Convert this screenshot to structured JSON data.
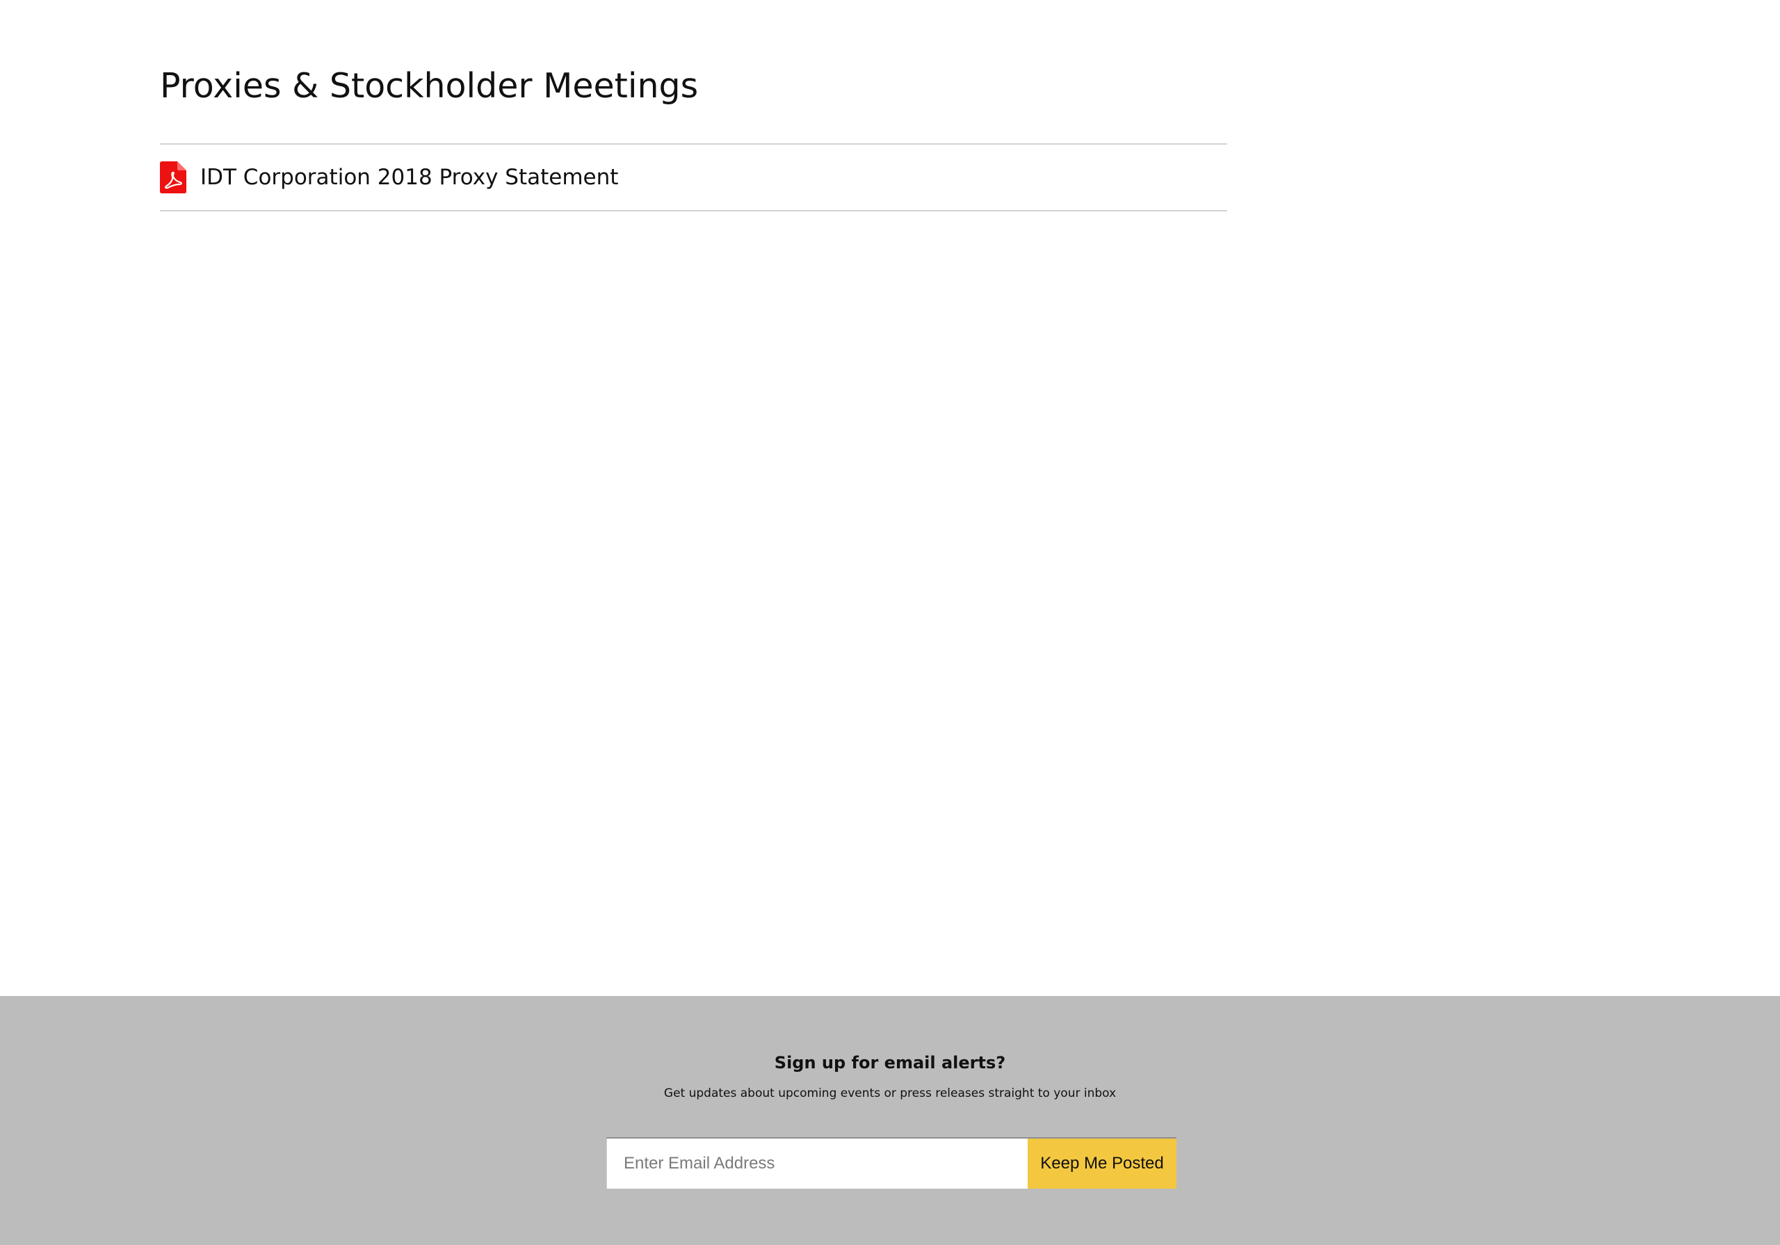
{
  "page": {
    "title": "Proxies & Stockholder Meetings"
  },
  "documents": [
    {
      "label": "IDT Corporation 2018 Proxy Statement",
      "icon": "pdf-icon"
    }
  ],
  "footer": {
    "title": "Sign up for email alerts?",
    "subtitle": "Get updates about upcoming events or press releases straight to your inbox",
    "email_placeholder": "Enter Email Address",
    "email_value": "",
    "submit_label": "Keep Me Posted"
  },
  "colors": {
    "footer_background": "#bcbcbc",
    "button_background": "#f3c740",
    "pdf_icon": "#ee1111",
    "divider": "#d4d4d4"
  }
}
